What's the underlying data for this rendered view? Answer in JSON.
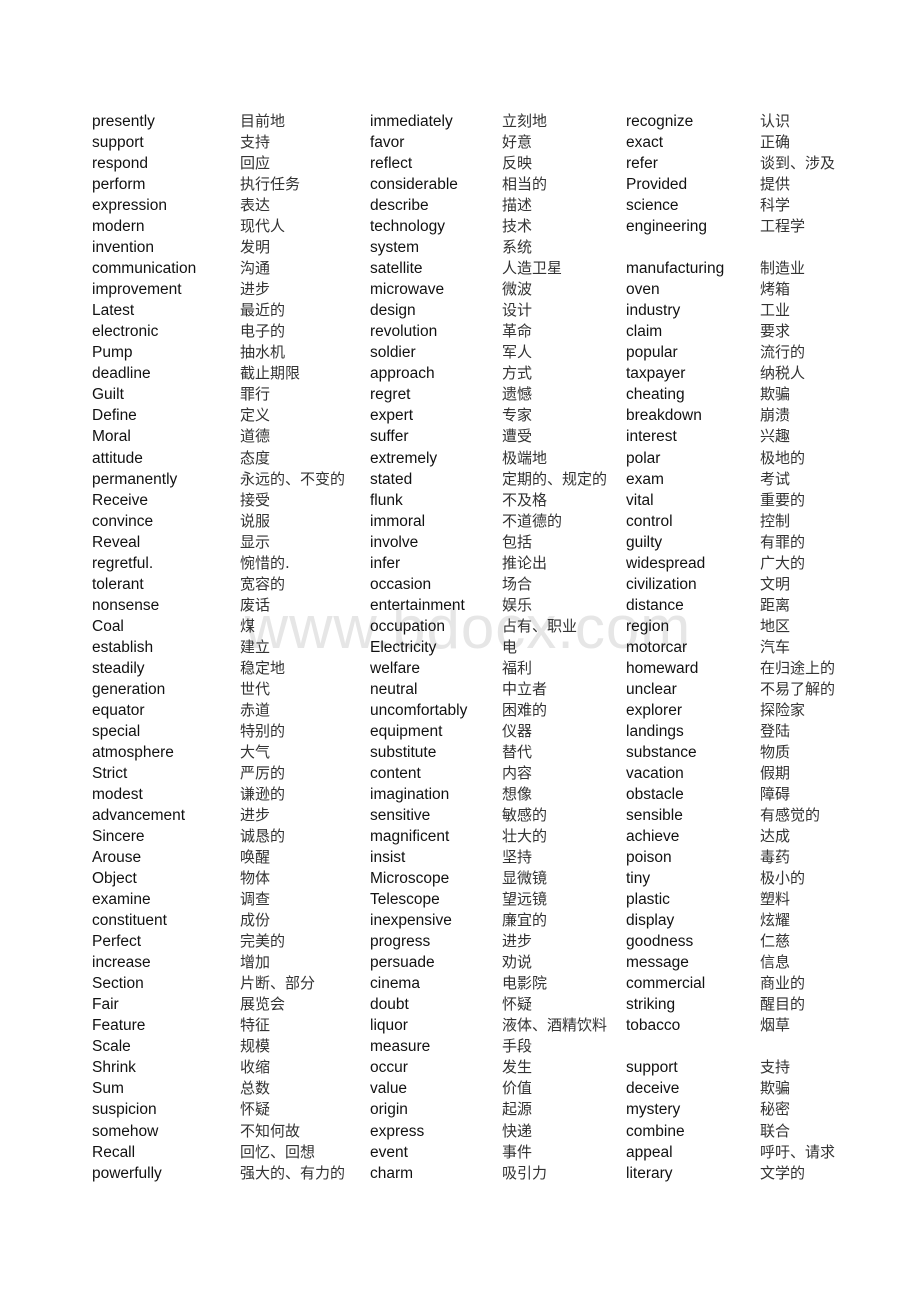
{
  "watermark": "www.bdocx.com",
  "columns": [
    {
      "entries": [
        {
          "en": "presently",
          "zh": "目前地"
        },
        {
          "en": "support",
          "zh": "支持"
        },
        {
          "en": "respond",
          "zh": "回应"
        },
        {
          "en": "perform",
          "zh": "执行任务"
        },
        {
          "en": "expression",
          "zh": "表达"
        },
        {
          "en": "modern",
          "zh": "现代人"
        },
        {
          "en": "invention",
          "zh": "发明"
        },
        {
          "en": "communication",
          "zh": "沟通"
        },
        {
          "en": "improvement",
          "zh": "进步"
        },
        {
          "en": "Latest",
          "zh": "最近的"
        },
        {
          "en": "electronic",
          "zh": "电子的"
        },
        {
          "en": "Pump",
          "zh": "抽水机"
        },
        {
          "en": "deadline",
          "zh": "截止期限"
        },
        {
          "en": "Guilt",
          "zh": "罪行"
        },
        {
          "en": "Define",
          "zh": "定义"
        },
        {
          "en": "Moral",
          "zh": "道德"
        },
        {
          "en": "attitude",
          "zh": "态度"
        },
        {
          "en": "permanently",
          "zh": "永远的、不变的"
        },
        {
          "en": "Receive",
          "zh": "接受"
        },
        {
          "en": "convince",
          "zh": "说服"
        },
        {
          "en": "Reveal",
          "zh": "显示"
        },
        {
          "en": "regretful.",
          "zh": "惋惜的."
        },
        {
          "en": "tolerant",
          "zh": "宽容的"
        },
        {
          "en": "nonsense",
          "zh": "废话"
        },
        {
          "en": "Coal",
          "zh": "煤"
        },
        {
          "en": "establish",
          "zh": "建立"
        },
        {
          "en": "steadily",
          "zh": "稳定地"
        },
        {
          "en": "generation",
          "zh": "世代"
        },
        {
          "en": "equator",
          "zh": "赤道"
        },
        {
          "en": "special",
          "zh": "特别的"
        },
        {
          "en": "atmosphere",
          "zh": "大气"
        },
        {
          "en": "Strict",
          "zh": "严厉的"
        },
        {
          "en": "modest",
          "zh": "谦逊的"
        },
        {
          "en": "advancement",
          "zh": "进步"
        },
        {
          "en": "Sincere",
          "zh": "诚恳的"
        },
        {
          "en": "Arouse",
          "zh": "唤醒"
        },
        {
          "en": "Object",
          "zh": "物体"
        },
        {
          "en": "examine",
          "zh": "调查"
        },
        {
          "en": "constituent",
          "zh": "成份"
        },
        {
          "en": "Perfect",
          "zh": "完美的"
        },
        {
          "en": "increase",
          "zh": "增加"
        },
        {
          "en": "Section",
          "zh": "片断、部分"
        },
        {
          "en": "Fair",
          "zh": "展览会"
        },
        {
          "en": "Feature",
          "zh": "特征"
        },
        {
          "en": "Scale",
          "zh": "规模"
        },
        {
          "en": "Shrink",
          "zh": "收缩"
        },
        {
          "en": "Sum",
          "zh": "总数"
        },
        {
          "en": "suspicion",
          "zh": "怀疑"
        },
        {
          "en": "somehow",
          "zh": "不知何故"
        },
        {
          "en": "Recall",
          "zh": "回忆、回想"
        },
        {
          "en": "powerfully",
          "zh": "强大的、有力的"
        }
      ]
    },
    {
      "entries": [
        {
          "en": "immediately",
          "zh": "立刻地"
        },
        {
          "en": "favor",
          "zh": "好意"
        },
        {
          "en": "reflect",
          "zh": "反映"
        },
        {
          "en": "considerable",
          "zh": "相当的"
        },
        {
          "en": "describe",
          "zh": "描述"
        },
        {
          "en": "technology",
          "zh": "技术"
        },
        {
          "en": "system",
          "zh": "系统"
        },
        {
          "en": "satellite",
          "zh": "人造卫星"
        },
        {
          "en": "microwave",
          "zh": "微波"
        },
        {
          "en": "design",
          "zh": "设计"
        },
        {
          "en": "revolution",
          "zh": "革命"
        },
        {
          "en": "soldier",
          "zh": "军人"
        },
        {
          "en": "approach",
          "zh": "方式"
        },
        {
          "en": "regret",
          "zh": "遗憾"
        },
        {
          "en": "expert",
          "zh": "专家"
        },
        {
          "en": "suffer",
          "zh": "遭受"
        },
        {
          "en": "extremely",
          "zh": "极端地"
        },
        {
          "en": "stated",
          "zh": "定期的、规定的"
        },
        {
          "en": "flunk",
          "zh": "不及格"
        },
        {
          "en": "immoral",
          "zh": "不道德的"
        },
        {
          "en": "involve",
          "zh": "包括"
        },
        {
          "en": "infer",
          "zh": "推论出"
        },
        {
          "en": "occasion",
          "zh": "场合"
        },
        {
          "en": "entertainment",
          "zh": "娱乐"
        },
        {
          "en": "occupation",
          "zh": "占有、职业"
        },
        {
          "en": "Electricity",
          "zh": "电"
        },
        {
          "en": "welfare",
          "zh": "福利"
        },
        {
          "en": "neutral",
          "zh": "中立者"
        },
        {
          "en": "uncomfortably",
          "zh": "困难的"
        },
        {
          "en": "equipment",
          "zh": "仪器"
        },
        {
          "en": "substitute",
          "zh": "替代"
        },
        {
          "en": "content",
          "zh": "内容"
        },
        {
          "en": "imagination",
          "zh": "想像"
        },
        {
          "en": "sensitive",
          "zh": "敏感的"
        },
        {
          "en": "magnificent",
          "zh": "壮大的"
        },
        {
          "en": "insist",
          "zh": "坚持"
        },
        {
          "en": "Microscope",
          "zh": "显微镜"
        },
        {
          "en": "Telescope",
          "zh": "望远镜"
        },
        {
          "en": "inexpensive",
          "zh": "廉宜的"
        },
        {
          "en": "progress",
          "zh": "进步"
        },
        {
          "en": "persuade",
          "zh": "劝说"
        },
        {
          "en": "cinema",
          "zh": "电影院"
        },
        {
          "en": "doubt",
          "zh": "怀疑"
        },
        {
          "en": "liquor",
          "zh": "液体、酒精饮料"
        },
        {
          "en": "measure",
          "zh": "手段"
        },
        {
          "en": "occur",
          "zh": "发生"
        },
        {
          "en": "value",
          "zh": "价值"
        },
        {
          "en": "origin",
          "zh": "起源"
        },
        {
          "en": "express",
          "zh": "快递"
        },
        {
          "en": "event",
          "zh": "事件"
        },
        {
          "en": "charm",
          "zh": "吸引力"
        }
      ]
    },
    {
      "entries": [
        {
          "en": "recognize",
          "zh": "认识"
        },
        {
          "en": "exact",
          "zh": "正确"
        },
        {
          "en": "refer",
          "zh": "谈到、涉及"
        },
        {
          "en": "Provided",
          "zh": "提供"
        },
        {
          "en": "science",
          "zh": "科学"
        },
        {
          "en": "engineering",
          "zh": "工程学"
        },
        {
          "en": "",
          "zh": ""
        },
        {
          "en": "manufacturing",
          "zh": "制造业"
        },
        {
          "en": "oven",
          "zh": "烤箱"
        },
        {
          "en": "industry",
          "zh": "工业"
        },
        {
          "en": "claim",
          "zh": "要求"
        },
        {
          "en": "popular",
          "zh": "流行的"
        },
        {
          "en": "taxpayer",
          "zh": "纳税人"
        },
        {
          "en": "cheating",
          "zh": "欺骗"
        },
        {
          "en": "breakdown",
          "zh": "崩溃"
        },
        {
          "en": "interest",
          "zh": "兴趣"
        },
        {
          "en": "polar",
          "zh": "极地的"
        },
        {
          "en": "exam",
          "zh": "考试"
        },
        {
          "en": "vital",
          "zh": "重要的"
        },
        {
          "en": "control",
          "zh": "控制"
        },
        {
          "en": "guilty",
          "zh": "有罪的"
        },
        {
          "en": "widespread",
          "zh": "广大的"
        },
        {
          "en": "civilization",
          "zh": "文明"
        },
        {
          "en": "distance",
          "zh": "距离"
        },
        {
          "en": "region",
          "zh": "地区"
        },
        {
          "en": "motorcar",
          "zh": "汽车"
        },
        {
          "en": "homeward",
          "zh": "在归途上的"
        },
        {
          "en": "unclear",
          "zh": "不易了解的"
        },
        {
          "en": "explorer",
          "zh": "探险家"
        },
        {
          "en": "landings",
          "zh": "登陆"
        },
        {
          "en": "substance",
          "zh": "物质"
        },
        {
          "en": "vacation",
          "zh": "假期"
        },
        {
          "en": "obstacle",
          "zh": "障碍"
        },
        {
          "en": "sensible",
          "zh": "有感觉的"
        },
        {
          "en": "achieve",
          "zh": "达成"
        },
        {
          "en": "poison",
          "zh": "毒药"
        },
        {
          "en": "tiny",
          "zh": "极小的"
        },
        {
          "en": "plastic",
          "zh": "塑料"
        },
        {
          "en": "display",
          "zh": "炫耀"
        },
        {
          "en": "goodness",
          "zh": "仁慈"
        },
        {
          "en": "message",
          "zh": "信息"
        },
        {
          "en": "commercial",
          "zh": "商业的"
        },
        {
          "en": "striking",
          "zh": "醒目的"
        },
        {
          "en": "tobacco",
          "zh": "烟草"
        },
        {
          "en": "",
          "zh": ""
        },
        {
          "en": "support",
          "zh": "支持"
        },
        {
          "en": "deceive",
          "zh": "欺骗"
        },
        {
          "en": "mystery",
          "zh": "秘密"
        },
        {
          "en": "combine",
          "zh": "联合"
        },
        {
          "en": "appeal",
          "zh": "呼吁、请求"
        },
        {
          "en": "literary",
          "zh": "文学的"
        }
      ]
    }
  ]
}
